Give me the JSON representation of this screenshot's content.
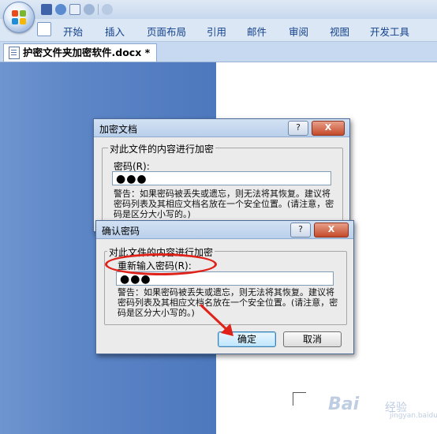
{
  "ribbon": {
    "tabs": [
      "开始",
      "插入",
      "页面布局",
      "引用",
      "邮件",
      "审阅",
      "视图",
      "开发工具"
    ]
  },
  "document": {
    "tab_title": "护密文件夹加密软件.docx *"
  },
  "encrypt_dialog": {
    "title": "加密文档",
    "help_btn": "?",
    "close_btn": "X",
    "group_legend": "对此文件的内容进行加密",
    "password_label": "密码(R):",
    "password_value": "●●●",
    "warning": "警告：如果密码被丢失或遗忘，则无法将其恢复。建议将密码列表及其相应文档名放在一个安全位置。(请注意，密码是区分大小写的。)"
  },
  "confirm_dialog": {
    "title": "确认密码",
    "help_btn": "?",
    "close_btn": "X",
    "group_legend": "对此文件的内容进行加密",
    "password_label": "重新输入密码(R):",
    "password_value": "●●●",
    "warning": "警告：如果密码被丢失或遗忘，则无法将其恢复。建议将密码列表及其相应文档名放在一个安全位置。(请注意，密码是区分大小写的。)",
    "ok_label": "确定",
    "cancel_label": "取消"
  },
  "watermark": {
    "brand": "Bai",
    "cn": "经验",
    "url": "jingyan.baidu.com"
  },
  "colors": {
    "annotation_red": "#e0231a",
    "workspace_blue": "#5d86c7"
  }
}
